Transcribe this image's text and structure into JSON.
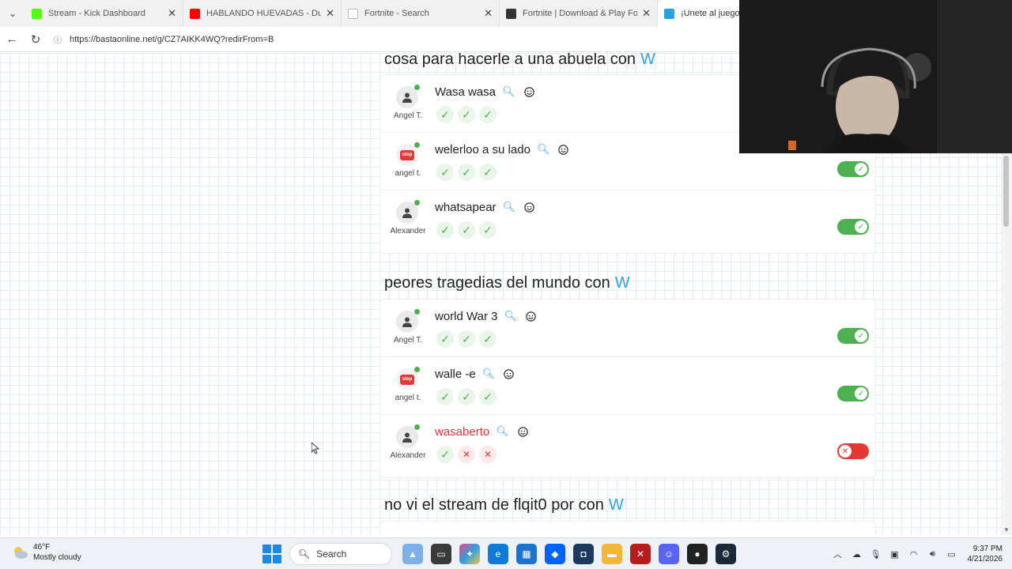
{
  "browser": {
    "tabs": [
      {
        "title": "Stream - Kick Dashboard",
        "color": "#53fc18",
        "active": false
      },
      {
        "title": "HABLANDO HUEVADAS - Duodéc",
        "color": "#ff0000",
        "active": false
      },
      {
        "title": "Fortnite - Search",
        "color": "#ffffff",
        "active": false
      },
      {
        "title": "Fortnite | Download & Play For Fre",
        "color": "#333333",
        "active": false
      },
      {
        "title": "¡Únete al juego Ba",
        "color": "#2f9fe0",
        "active": true
      }
    ],
    "url": "https://bastaonline.net/g/CZ7AIKK4WQ?redirFrom=B"
  },
  "game": {
    "categories": [
      {
        "title": "cosa para hacerle a una abuela con",
        "letter": "W",
        "answers": [
          {
            "player": "Angel T.",
            "answer": "Wasa wasa",
            "avatar": "silhouette",
            "votes": [
              "yes",
              "yes",
              "yes"
            ],
            "valid": true,
            "toggle_visible": false
          },
          {
            "player": "angel t.",
            "answer": "welerloo a su lado",
            "avatar": "stop",
            "votes": [
              "yes",
              "yes",
              "yes"
            ],
            "valid": true,
            "toggle_visible": true
          },
          {
            "player": "Alexander",
            "answer": "whatsapear",
            "avatar": "silhouette",
            "votes": [
              "yes",
              "yes",
              "yes"
            ],
            "valid": true,
            "toggle_visible": true
          }
        ]
      },
      {
        "title": "peores tragedias del mundo con",
        "letter": "W",
        "answers": [
          {
            "player": "Angel T.",
            "answer": "world War 3",
            "avatar": "silhouette",
            "votes": [
              "yes",
              "yes",
              "yes"
            ],
            "valid": true,
            "toggle_visible": true
          },
          {
            "player": "angel t.",
            "answer": "walle -e",
            "avatar": "stop",
            "votes": [
              "yes",
              "yes",
              "yes"
            ],
            "valid": true,
            "toggle_visible": true
          },
          {
            "player": "Alexander",
            "answer": "wasaberto",
            "avatar": "silhouette",
            "votes": [
              "yes",
              "no",
              "no"
            ],
            "valid": false,
            "toggle_visible": true
          }
        ]
      },
      {
        "title": "no vi el stream de flqit0 por con",
        "letter": "W",
        "answers": []
      }
    ],
    "stop_label": "stop"
  },
  "taskbar": {
    "weather_temp": "46°F",
    "weather_desc": "Mostly cloudy",
    "search_placeholder": "Search",
    "time": "9:37 PM",
    "date": "4/21/2026"
  },
  "colors": {
    "accent": "#2f9fe0",
    "valid": "#4caf50",
    "invalid": "#e53935"
  }
}
